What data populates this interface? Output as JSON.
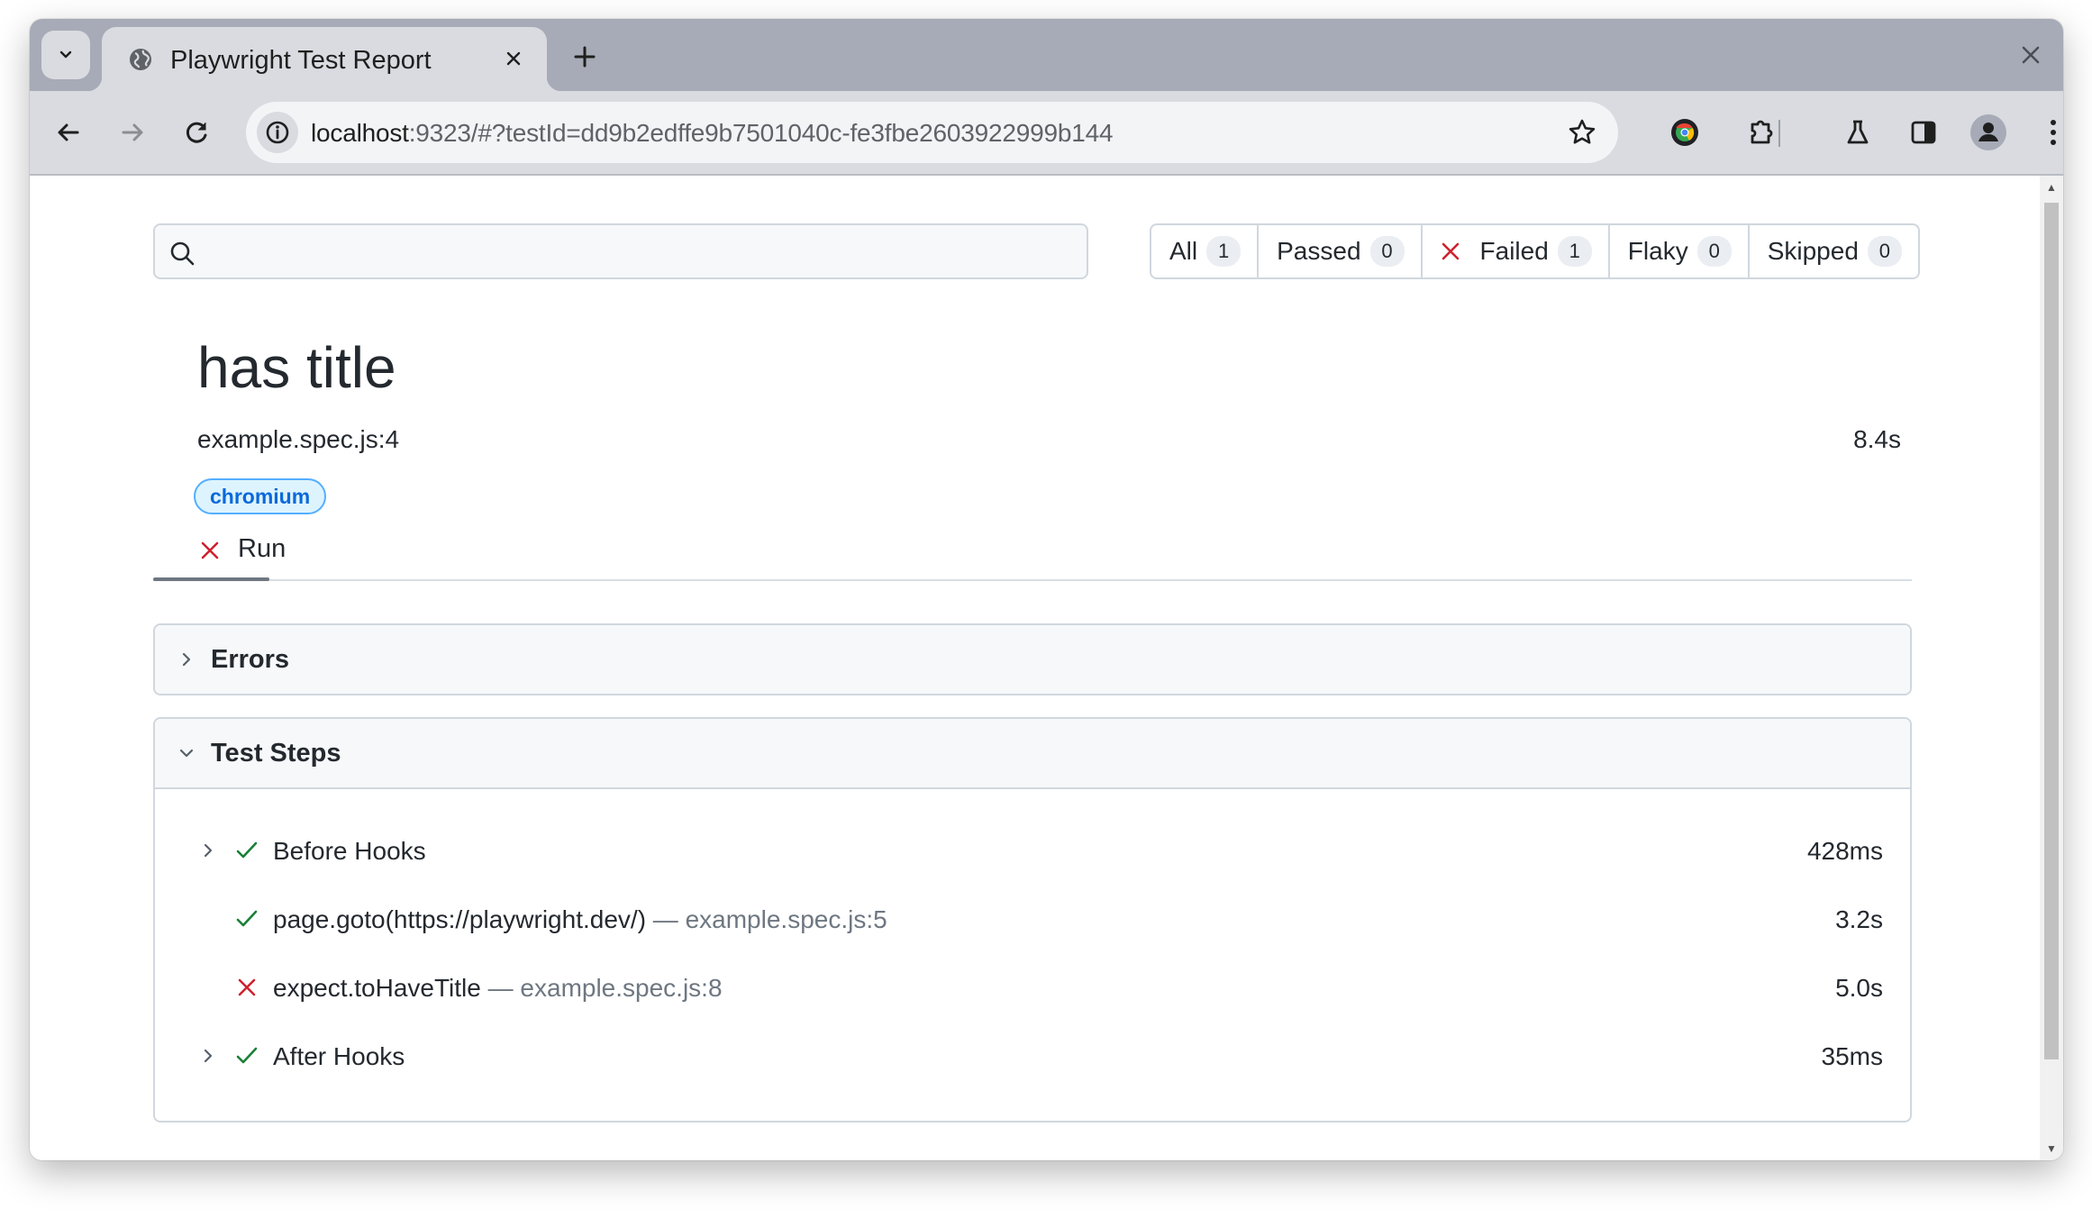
{
  "browser": {
    "tab_title": "Playwright Test Report",
    "url_host": "localhost",
    "url_rest": ":9323/#?testId=dd9b2edffe9b7501040c-fe3fbe2603922999b144"
  },
  "search": {
    "value": "",
    "placeholder": ""
  },
  "filters": [
    {
      "label": "All",
      "count": "1"
    },
    {
      "label": "Passed",
      "count": "0"
    },
    {
      "label": "Failed",
      "count": "1",
      "icon": "x-icon"
    },
    {
      "label": "Flaky",
      "count": "0"
    },
    {
      "label": "Skipped",
      "count": "0"
    }
  ],
  "test": {
    "title": "has title",
    "location": "example.spec.js:4",
    "duration": "8.4s",
    "project_badge": "chromium",
    "run_tab_label": "Run",
    "run_status": "failed"
  },
  "sections": {
    "errors_label": "Errors",
    "steps_label": "Test Steps"
  },
  "steps": [
    {
      "title": "Before Hooks",
      "location": "",
      "duration": "428ms",
      "status": "passed",
      "expandable": true
    },
    {
      "title": "page.goto(https://playwright.dev/)",
      "location": "— example.spec.js:5",
      "duration": "3.2s",
      "status": "passed",
      "expandable": false
    },
    {
      "title": "expect.toHaveTitle",
      "location": "— example.spec.js:8",
      "duration": "5.0s",
      "status": "failed",
      "expandable": false
    },
    {
      "title": "After Hooks",
      "location": "",
      "duration": "35ms",
      "status": "passed",
      "expandable": true
    }
  ],
  "colors": {
    "passed": "#1a7f37",
    "failed": "#cf222e",
    "badge_text": "#0969da",
    "badge_bg": "#ddf4ff"
  }
}
